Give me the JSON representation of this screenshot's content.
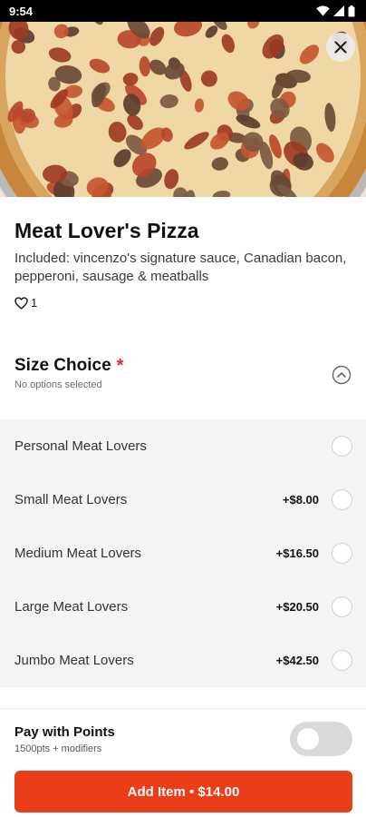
{
  "status_bar": {
    "time": "9:54",
    "icons": [
      "wifi-icon",
      "cellular-icon",
      "battery-icon"
    ]
  },
  "hero": {
    "image": "meat-lovers-pizza-photo",
    "close_icon": "close-icon"
  },
  "item": {
    "title": "Meat Lover's Pizza",
    "description": "Included: vincenzo's signature sauce, Canadian bacon, pepperoni, sausage & meatballs",
    "likes_icon": "heart-outline-icon",
    "likes_count": "1"
  },
  "size_section": {
    "title": "Size Choice",
    "required_marker": "*",
    "subtitle": "No options selected",
    "collapse_icon": "chevron-up-circle-icon",
    "options": [
      {
        "label": "Personal Meat Lovers",
        "price": ""
      },
      {
        "label": "Small Meat Lovers",
        "price": "+$8.00"
      },
      {
        "label": "Medium Meat Lovers",
        "price": "+$16.50"
      },
      {
        "label": "Large Meat Lovers",
        "price": "+$20.50"
      },
      {
        "label": "Jumbo Meat Lovers",
        "price": "+$42.50"
      }
    ]
  },
  "points": {
    "title": "Pay with Points",
    "subtitle": "1500pts + modifiers",
    "enabled": false
  },
  "add_button": {
    "label": "Add Item • $14.00"
  },
  "colors": {
    "accent": "#ec3d1b",
    "required": "#d92c2c",
    "options_background": "#f4f4f4",
    "status_bar": "#000000"
  }
}
